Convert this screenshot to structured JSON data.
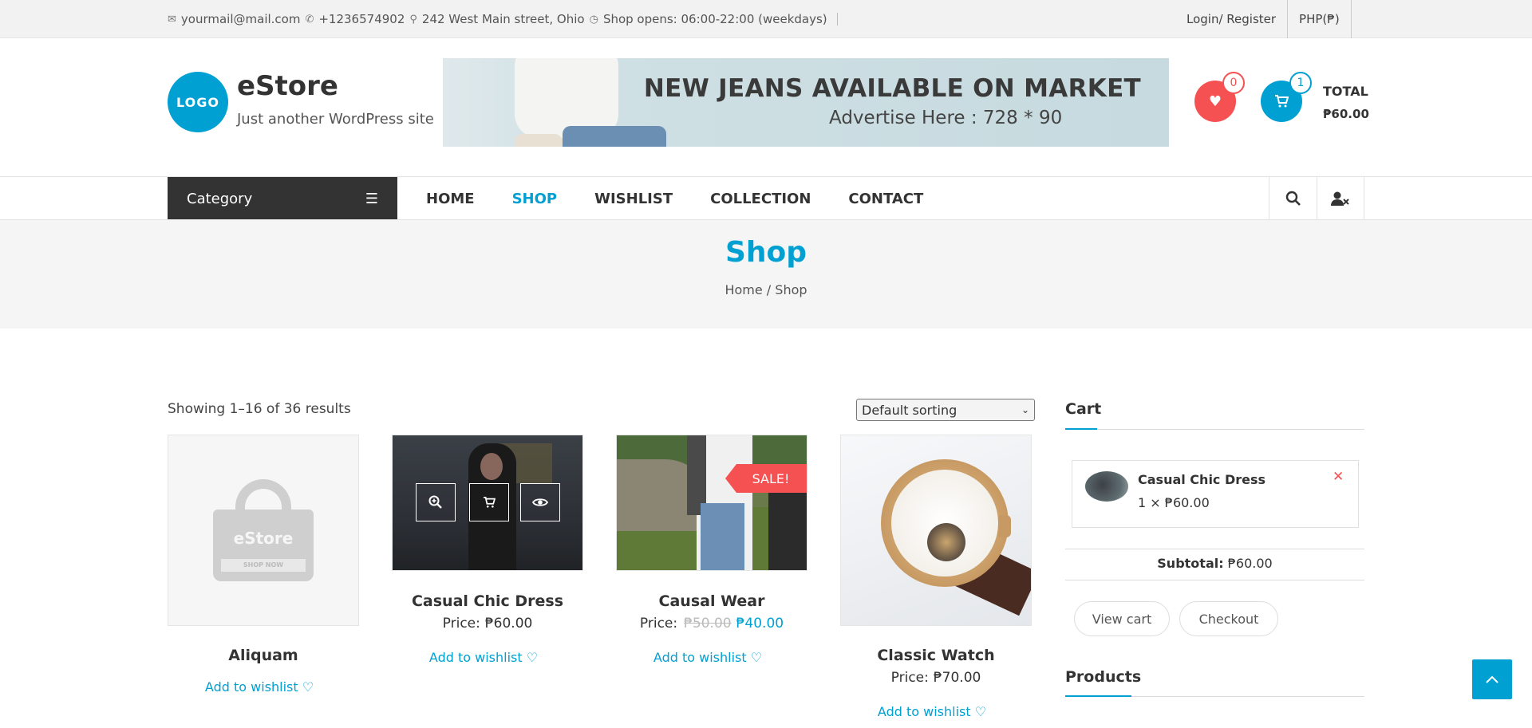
{
  "topbar": {
    "email": "yourmail@mail.com",
    "phone": "+1236574902",
    "address": "242 West Main street, Ohio",
    "hours": "Shop opens: 06:00-22:00 (weekdays)",
    "login": "Login/ Register",
    "currency": "PHP(₱)"
  },
  "header": {
    "logo_text": "LOGO",
    "site_title": "eStore",
    "site_desc": "Just another WordPress site",
    "banner_title": "NEW JEANS AVAILABLE ON MARKET",
    "banner_sub": "Advertise Here : 728 * 90",
    "wishlist_count": "0",
    "cart_count": "1",
    "total_label": "TOTAL",
    "total_value": "₱60.00"
  },
  "nav": {
    "category_label": "Category",
    "items": [
      "HOME",
      "SHOP",
      "WISHLIST",
      "COLLECTION",
      "CONTACT"
    ],
    "active": "SHOP"
  },
  "page": {
    "title": "Shop",
    "breadcrumb": "Home / Shop"
  },
  "shop": {
    "result_count": "Showing 1–16 of 36 results",
    "sorting": "Default sorting",
    "placeholder_brand": "eStore",
    "placeholder_cta": "SHOP NOW",
    "sale_badge": "SALE!",
    "wishlist_label": "Add to wishlist",
    "price_label": "Price:",
    "products": [
      {
        "name": "Aliquam",
        "price": ""
      },
      {
        "name": "Casual Chic Dress",
        "price": "₱60.00"
      },
      {
        "name": "Causal Wear",
        "old_price": "₱50.00",
        "sale_price": "₱40.00"
      },
      {
        "name": "Classic Watch",
        "price": "₱70.00"
      }
    ]
  },
  "sidebar": {
    "cart_heading": "Cart",
    "cart_item": {
      "name": "Casual Chic Dress",
      "qty": "1 × ₱60.00"
    },
    "subtotal_label": "Subtotal:",
    "subtotal_value": "₱60.00",
    "view_cart": "View cart",
    "checkout": "Checkout",
    "products_heading": "Products"
  },
  "colors": {
    "accent": "#00a0d2",
    "sale": "#f55052",
    "dark": "#333333"
  },
  "icons": [
    "envelope-icon",
    "phone-icon",
    "map-marker-icon",
    "clock-icon",
    "heart-icon",
    "cart-icon",
    "bars-icon",
    "search-icon",
    "user-icon",
    "zoom-icon",
    "eye-icon",
    "close-icon",
    "chevron-up-icon"
  ]
}
